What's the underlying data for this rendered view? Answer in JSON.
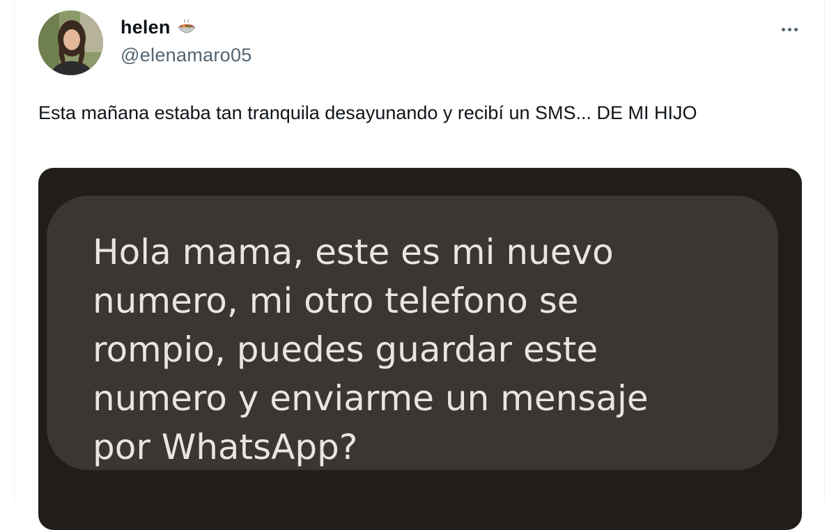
{
  "author": {
    "display_name": "helen",
    "emoji": "🍲",
    "handle": "@elenamaro05"
  },
  "tweet": {
    "text": "Esta mañana estaba tan tranquila desayunando y recibí un SMS... DE MI HIJO"
  },
  "media": {
    "sms_message": "Hola mama, este es mi nuevo\nnumero, mi otro telefono se\nrompio, puedes guardar este\nnumero y enviarme un mensaje\npor WhatsApp?"
  },
  "icons": {
    "more": "more-horizontal-icon",
    "emoji": "stew-bowl-icon"
  },
  "colors": {
    "name": "#0f1419",
    "handle": "#536471",
    "media_background": "#211e1a",
    "bubble": "#3a3632",
    "bubble_text": "#e9e5df"
  }
}
